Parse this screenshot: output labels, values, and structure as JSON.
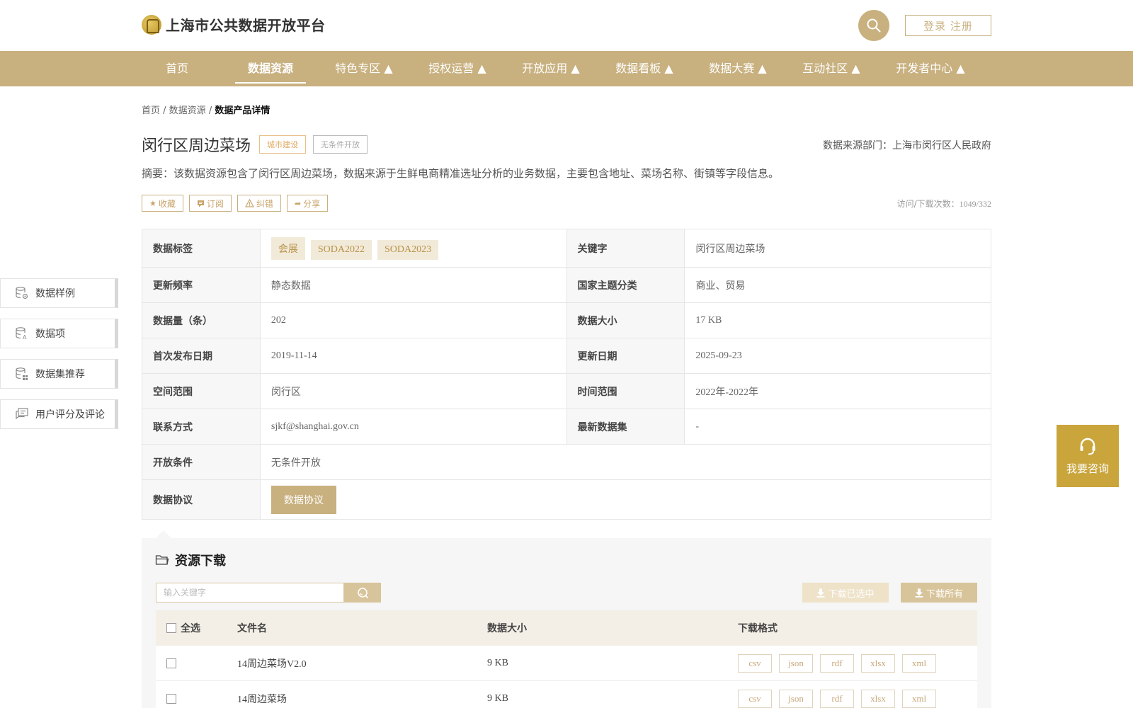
{
  "header": {
    "logo_text": "上海市公共数据开放平台",
    "login_label": "登录 注册"
  },
  "nav": [
    {
      "label": "首页"
    },
    {
      "label": "数据资源"
    },
    {
      "label": "特色专区 ▲"
    },
    {
      "label": "授权运营 ▲"
    },
    {
      "label": "开放应用 ▲"
    },
    {
      "label": "数据看板 ▲"
    },
    {
      "label": "数据大赛 ▲"
    },
    {
      "label": "互动社区 ▲"
    },
    {
      "label": "开发者中心 ▲"
    }
  ],
  "breadcrumb": {
    "home": "首页",
    "sep": " / ",
    "resources": "数据资源",
    "current": "数据产品详情"
  },
  "product": {
    "title": "闵行区周边菜场",
    "tag_category": "城市建设",
    "tag_open": "无条件开放",
    "source_dept": "数据来源部门：上海市闵行区人民政府",
    "summary": "摘要：该数据资源包含了闵行区周边菜场，数据来源于生鲜电商精准选址分析的业务数据，主要包含地址、菜场名称、街镇等字段信息。",
    "counts_label": "访问/下载次数：",
    "counts_value": "1049/332"
  },
  "actions": {
    "favorite": "收藏",
    "subscribe": "订阅",
    "correct": "纠错",
    "share": "分享"
  },
  "info": {
    "tags_label": "数据标签",
    "tags": [
      "会展",
      "SODA2022",
      "SODA2023"
    ],
    "keyword_label": "关键字",
    "keyword_value": "闵行区周边菜场",
    "freq_label": "更新频率",
    "freq_value": "静态数据",
    "theme_label": "国家主题分类",
    "theme_value": "商业、贸易",
    "count_label": "数据量（条）",
    "count_value": "202",
    "size_label": "数据大小",
    "size_value": "17 KB",
    "first_pub_label": "首次发布日期",
    "first_pub_value": "2019-11-14",
    "updated_label": "更新日期",
    "updated_value": "2025-09-23",
    "space_label": "空间范围",
    "space_value": "闵行区",
    "time_label": "时间范围",
    "time_value": "2022年-2022年",
    "contact_label": "联系方式",
    "contact_value": "sjkf@shanghai.gov.cn",
    "latest_label": "最新数据集",
    "latest_value": "-",
    "condition_label": "开放条件",
    "condition_value": "无条件开放",
    "protocol_label": "数据协议",
    "protocol_button": "数据协议"
  },
  "sidebar": [
    {
      "label": "数据样例"
    },
    {
      "label": "数据项"
    },
    {
      "label": "数据集推荐"
    },
    {
      "label": "用户评分及评论"
    }
  ],
  "consult": {
    "label": "我要咨询"
  },
  "resources": {
    "title": "资源下载",
    "search_placeholder": "输入关键字",
    "download_selected": "下载已选中",
    "download_all": "下载所有",
    "headers": {
      "select_all": "全选",
      "filename": "文件名",
      "size": "数据大小",
      "format": "下载格式"
    },
    "files": [
      {
        "name": "14周边菜场V2.0",
        "size": "9 KB",
        "formats": [
          "csv",
          "json",
          "rdf",
          "xlsx",
          "xml"
        ]
      },
      {
        "name": "14周边菜场",
        "size": "9 KB",
        "formats": [
          "csv",
          "json",
          "rdf",
          "xlsx",
          "xml"
        ]
      }
    ]
  },
  "colors": {
    "brand": "#c8b07f",
    "consult": "#c9a53c"
  }
}
